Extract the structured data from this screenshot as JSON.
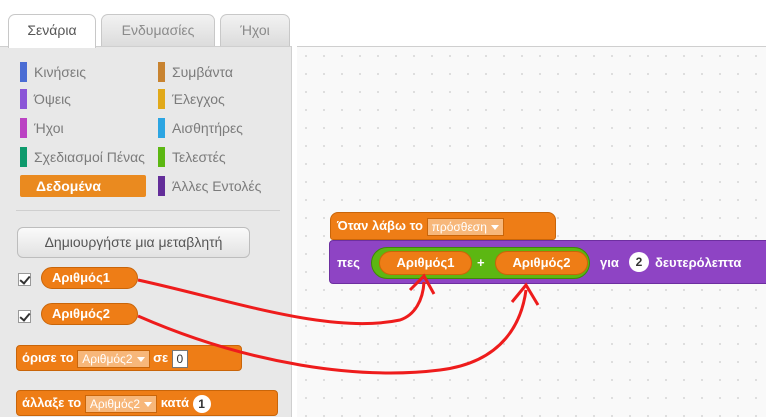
{
  "tabs": [
    {
      "label": "Σενάρια",
      "active": true
    },
    {
      "label": "Ενδυμασίες",
      "active": false
    },
    {
      "label": "Ήχοι",
      "active": false
    }
  ],
  "categories": [
    {
      "label": "Κινήσεις",
      "color": "#4a6cd4"
    },
    {
      "label": "Συμβάντα",
      "color": "#c88330"
    },
    {
      "label": "Όψεις",
      "color": "#8a55d7"
    },
    {
      "label": "Έλεγχος",
      "color": "#e1a91a"
    },
    {
      "label": "Ήχοι",
      "color": "#bb42c3"
    },
    {
      "label": "Αισθητήρες",
      "color": "#2ca5e2"
    },
    {
      "label": "Σχεδιασμοί Πένας",
      "color": "#0e9a6c"
    },
    {
      "label": "Τελεστές",
      "color": "#5cb712"
    },
    {
      "label": "Δεδομένα",
      "color": "#ee7d16",
      "selected": true
    },
    {
      "label": "Άλλες Εντολές",
      "color": "#632d99"
    }
  ],
  "palette": {
    "make_variable": "Δημιουργήστε μια μεταβλητή",
    "var1": "Αριθμός1",
    "var2": "Αριθμός2",
    "set_block": {
      "prefix": "όρισε το",
      "var": "Αριθμός2",
      "mid": "σε",
      "value": "0"
    },
    "change_block": {
      "prefix": "άλλαξε το",
      "var": "Αριθμός2",
      "mid": "κατά",
      "value": "1"
    }
  },
  "script": {
    "hat_prefix": "Όταν λάβω το",
    "hat_message": "πρόσθεση",
    "say_prefix": "πες",
    "left_var": "Αριθμός1",
    "plus": "+",
    "right_var": "Αριθμός2",
    "for_label": "για",
    "seconds": "2",
    "seconds_label": "δευτερόλεπτα"
  },
  "colors": {
    "data": "#ee7d16",
    "looks": "#8e44c4",
    "operators": "#5cb712",
    "arrow": "#ee1c1c"
  }
}
